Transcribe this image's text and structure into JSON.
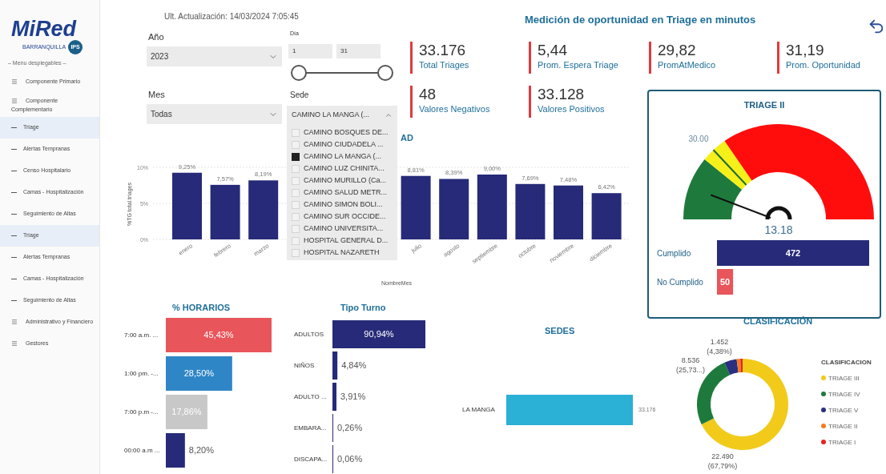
{
  "sidebar": {
    "logo": {
      "name": "MiRed",
      "tagline": "BARRANQUILLA",
      "badge": "IPS"
    },
    "menu_caption": "– Menu desplegables –",
    "items": [
      {
        "kind": "group",
        "label": "Componente Primario",
        "selected": false,
        "wrap": false
      },
      {
        "kind": "group",
        "label": "Componente Complementario",
        "selected": false,
        "wrap": true
      },
      {
        "kind": "page",
        "label": "Triage",
        "selected": true,
        "wrap": false
      },
      {
        "kind": "page",
        "label": "Alertas Tempranas",
        "selected": false,
        "wrap": false
      },
      {
        "kind": "page",
        "label": "Censo Hospitalario",
        "selected": false,
        "wrap": false
      },
      {
        "kind": "page",
        "label": "Camas - Hospitalización",
        "selected": false,
        "wrap": false
      },
      {
        "kind": "page",
        "label": "Seguimiento de Altas",
        "selected": false,
        "wrap": false
      },
      {
        "kind": "page",
        "label": "Triage",
        "selected": true,
        "wrap": false
      },
      {
        "kind": "page",
        "label": "Alertas Tempranas",
        "selected": false,
        "wrap": false
      },
      {
        "kind": "page",
        "label": "Camas - Hospitalización",
        "selected": false,
        "wrap": false
      },
      {
        "kind": "page",
        "label": "Seguimiento de Altas",
        "selected": false,
        "wrap": false
      },
      {
        "kind": "group",
        "label": "Administrativo y Financiero",
        "selected": false,
        "wrap": false
      },
      {
        "kind": "group",
        "label": "Gestores",
        "selected": false,
        "wrap": false
      }
    ]
  },
  "updated": "Ult. Actualización: 14/03/2024 7:05:45",
  "filters": {
    "year": {
      "label": "Año",
      "value": "2023"
    },
    "month": {
      "label": "Mes",
      "value": "Todas"
    },
    "day": {
      "label": "Día",
      "from": "1",
      "to": "31"
    },
    "sede": {
      "label": "Sede",
      "value": "CAMINO LA MANGA (...",
      "expanded": true,
      "options": [
        {
          "label": "CAMINO BOSQUES DE...",
          "selected": false
        },
        {
          "label": "CAMINO CIUDADELA ...",
          "selected": false
        },
        {
          "label": "CAMINO LA MANGA (...",
          "selected": true
        },
        {
          "label": "CAMINO LUZ CHINITA...",
          "selected": false
        },
        {
          "label": "CAMINO MURILLO (Ca...",
          "selected": false
        },
        {
          "label": "CAMINO SALUD METR...",
          "selected": false
        },
        {
          "label": "CAMINO SIMON BOLI...",
          "selected": false
        },
        {
          "label": "CAMINO SUR OCCIDE...",
          "selected": false
        },
        {
          "label": "CAMINO UNIVERSITA...",
          "selected": false
        },
        {
          "label": "HOSPITAL GENERAL D...",
          "selected": false
        },
        {
          "label": "HOSPITAL NAZARETH",
          "selected": false
        }
      ]
    }
  },
  "title": "Medición de oportunidad en Triage en minutos",
  "kpis": [
    {
      "value": "33.176",
      "label": "Total Triages"
    },
    {
      "value": "5,44",
      "label": "Prom. Espera Triage"
    },
    {
      "value": "29,82",
      "label": "PromAtMedico"
    },
    {
      "value": "31,19",
      "label": "Prom. Oportunidad"
    },
    {
      "value": "48",
      "label": "Valores Negativos"
    },
    {
      "value": "33.128",
      "label": "Valores Positivos"
    }
  ],
  "monthly_chart": {
    "chart_data": {
      "type": "bar",
      "title": "AD",
      "xlabel": "NombreMes",
      "ylabel": "%TG total.triages",
      "categories": [
        "enero",
        "febrero",
        "marzo",
        null,
        null,
        null,
        "julio",
        "agosto",
        "septiembre",
        "octubre",
        "noviembre",
        "diciembre"
      ],
      "values": [
        9.25,
        7.57,
        8.19,
        null,
        null,
        null,
        8.81,
        8.39,
        9.0,
        7.69,
        7.48,
        6.42
      ],
      "value_labels": [
        "9,25%",
        "7,57%",
        "8,19%",
        null,
        null,
        null,
        "8,81%",
        "8,39%",
        "9,00%",
        "7,69%",
        "7,48%",
        "6,42%"
      ],
      "ylim": [
        0,
        10
      ],
      "yticks": [
        {
          "value": 0,
          "label": "0%"
        },
        {
          "value": 5,
          "label": "5%"
        },
        {
          "value": 10,
          "label": "10%"
        }
      ],
      "color": "#262a78"
    }
  },
  "gauge_card": {
    "title": "TRIAGE II",
    "target": "30.00",
    "value": "13.18",
    "chart_data": {
      "type": "bar",
      "orientation": "horizontal",
      "categories": [
        "Cumplido",
        "No Cumplido"
      ],
      "values": [
        472,
        50
      ],
      "value_labels": [
        "472",
        "50"
      ],
      "colors": [
        "#262a78",
        "#e8555a"
      ]
    }
  },
  "horarios": {
    "chart_data": {
      "type": "bar",
      "orientation": "horizontal",
      "title": "% HORARIOS",
      "categories": [
        "7:00 a.m. ...",
        "1:00 pm. -...",
        "7:00 p.m -...",
        "00:00 a.m ..."
      ],
      "values": [
        45.43,
        28.5,
        17.86,
        8.2
      ],
      "value_labels": [
        "45,43%",
        "28,50%",
        "17,86%",
        "8,20%"
      ],
      "colors": [
        "#e8555a",
        "#2e86c6",
        "#c8c8c8",
        "#262a78"
      ]
    }
  },
  "tipo_turno": {
    "chart_data": {
      "type": "bar",
      "orientation": "horizontal",
      "title": "Tipo Turno",
      "categories": [
        "ADULTOS",
        "NIÑOS",
        "ADULTO ...",
        "EMBARA...",
        "DISCAPA..."
      ],
      "values": [
        90.94,
        4.84,
        3.91,
        0.26,
        0.06
      ],
      "value_labels": [
        "90,94%",
        "4,84%",
        "3,91%",
        "0,26%",
        "0,06%"
      ],
      "color": "#262a78"
    }
  },
  "sedes": {
    "title": "SEDES",
    "category": "LA MANGA",
    "value": "33.176"
  },
  "clasificacion": {
    "title": "CLASIFICACIÓN",
    "legend_title": "CLASIFICACION",
    "chart_data": {
      "type": "donut",
      "categories": [
        "TRIAGE III",
        "TRIAGE IV",
        "TRIAGE V",
        "TRIAGE II",
        "TRIAGE I"
      ],
      "values": [
        22490,
        8536,
        1452,
        440,
        258
      ],
      "colors": [
        "#f2ca19",
        "#1e7a3c",
        "#2b2f80",
        "#f47b20",
        "#e8231f"
      ],
      "value_labels": [
        "22.490 (67,79%)",
        "8.536 (25,73...)",
        "1.452 (4,38%)",
        null,
        null
      ],
      "legend": "right"
    }
  }
}
